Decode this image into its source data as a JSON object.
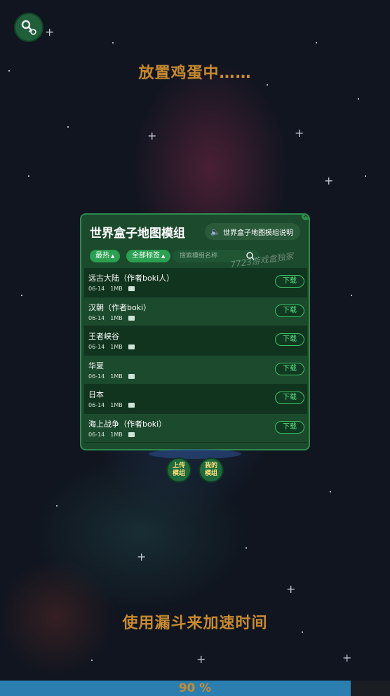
{
  "status": {
    "top_text": "放置鸡蛋中……",
    "bottom_text": "使用漏斗来加速时间"
  },
  "panel": {
    "title": "世界盒子地图模组",
    "info_button": "世界盒子地图模组说明",
    "filters": {
      "hot": "最热",
      "tags": "全部标签"
    },
    "search_placeholder": "搜索模组名称",
    "watermark": "7723游戏盒独家",
    "download_label": "下载",
    "items": [
      {
        "name": "远古大陆（作者boki人）",
        "date": "06-14",
        "size": "1MB"
      },
      {
        "name": "汉朝（作者boki）",
        "date": "06-14",
        "size": "1MB"
      },
      {
        "name": "王者峡谷",
        "date": "06-14",
        "size": "1MB"
      },
      {
        "name": "华夏",
        "date": "06-14",
        "size": "1MB"
      },
      {
        "name": "日本",
        "date": "06-14",
        "size": "1MB"
      },
      {
        "name": "海上战争（作者boki）",
        "date": "06-14",
        "size": "1MB"
      }
    ]
  },
  "buttons": {
    "upload": "上传\n模组",
    "mine": "我的\n模组"
  },
  "progress": {
    "percent": 90,
    "label": "90 %"
  },
  "icons": {
    "key": "key-gear-icon",
    "speaker": "speaker-icon",
    "search": "search-icon",
    "image": "image-icon"
  },
  "colors": {
    "accent_green": "#2aa050",
    "status_orange": "#c78a2f",
    "progress_blue": "#2a7fb0"
  }
}
